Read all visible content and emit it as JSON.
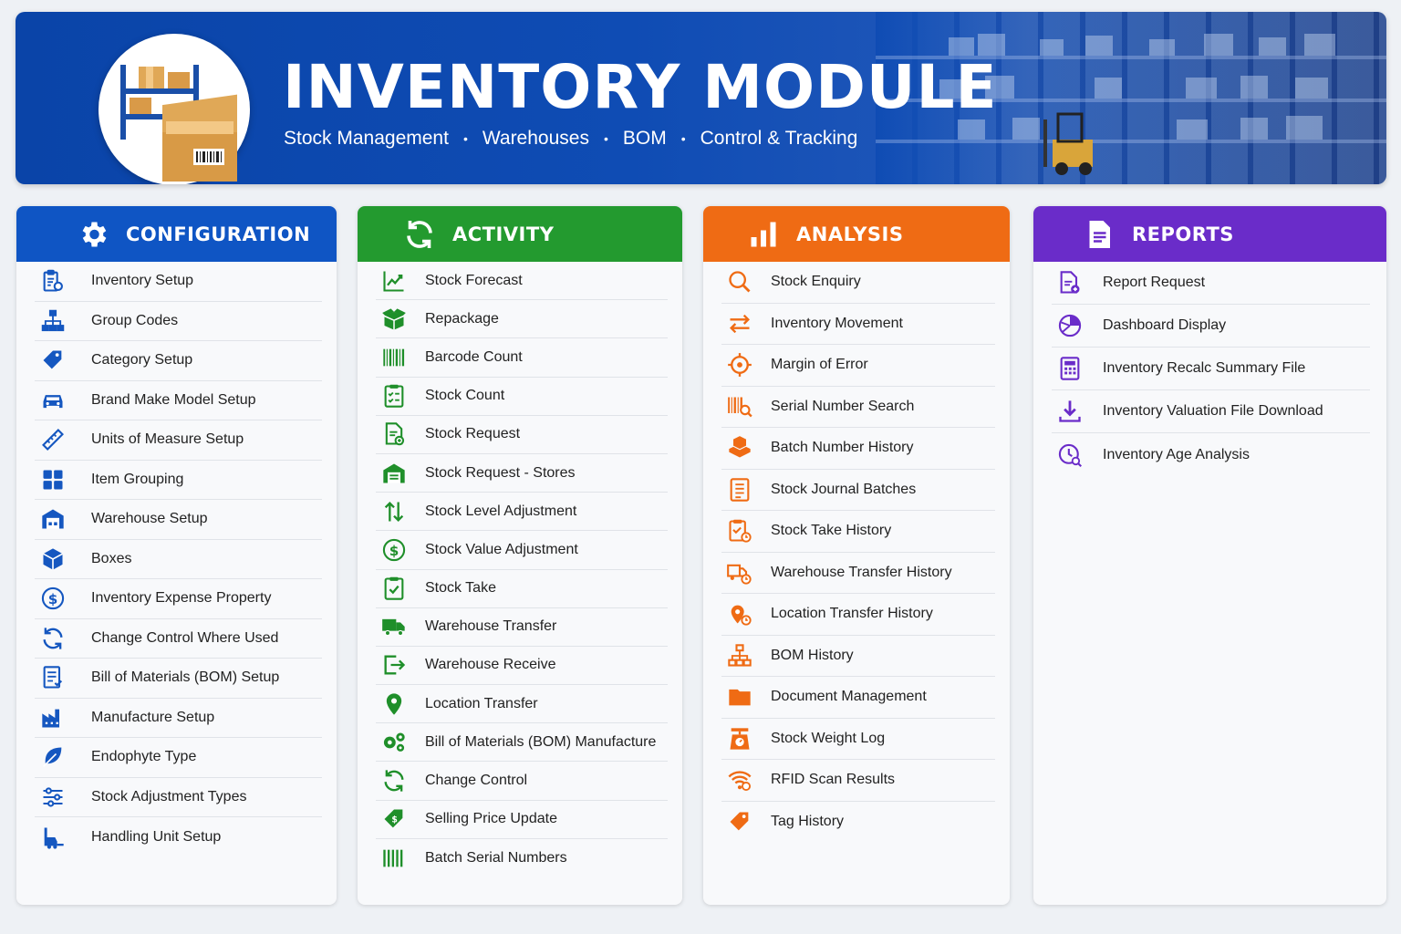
{
  "header": {
    "title": "INVENTORY MODULE",
    "subtitle_items": [
      "Stock Management",
      "Warehouses",
      "BOM",
      "Control & Tracking"
    ],
    "separator": "•"
  },
  "colors": {
    "configuration": "#0f55c4",
    "activity": "#239a2f",
    "analysis": "#ef6b14",
    "reports": "#6a2cc9",
    "banner": "#0f4cb4"
  },
  "configuration": {
    "title": "CONFIGURATION",
    "icon": "gear-icon",
    "items": [
      {
        "label": "Inventory Setup",
        "icon": "clipboard-gear-icon"
      },
      {
        "label": "Group Codes",
        "icon": "hierarchy-icon"
      },
      {
        "label": "Category Setup",
        "icon": "tag-icon"
      },
      {
        "label": "Brand Make Model Setup",
        "icon": "car-icon"
      },
      {
        "label": "Units of Measure Setup",
        "icon": "ruler-icon"
      },
      {
        "label": "Item Grouping",
        "icon": "grid-icon"
      },
      {
        "label": "Warehouse Setup",
        "icon": "warehouse-icon"
      },
      {
        "label": "Boxes",
        "icon": "box-icon"
      },
      {
        "label": "Inventory Expense Property",
        "icon": "dollar-circle-icon"
      },
      {
        "label": "Change Control Where Used",
        "icon": "refresh-icon"
      },
      {
        "label": "Bill of Materials (BOM) Setup",
        "icon": "document-list-icon"
      },
      {
        "label": "Manufacture Setup",
        "icon": "factory-icon"
      },
      {
        "label": "Endophyte Type",
        "icon": "leaf-icon"
      },
      {
        "label": "Stock Adjustment Types",
        "icon": "sliders-icon"
      },
      {
        "label": "Handling Unit Setup",
        "icon": "forklift-icon"
      }
    ]
  },
  "activity": {
    "title": "ACTIVITY",
    "icon": "sync-icon",
    "items": [
      {
        "label": "Stock Forecast",
        "icon": "trend-chart-icon"
      },
      {
        "label": "Repackage",
        "icon": "open-box-icon"
      },
      {
        "label": "Barcode Count",
        "icon": "barcode-icon"
      },
      {
        "label": "Stock Count",
        "icon": "checklist-icon"
      },
      {
        "label": "Stock Request",
        "icon": "document-request-icon"
      },
      {
        "label": "Stock Request - Stores",
        "icon": "store-icon"
      },
      {
        "label": "Stock Level Adjustment",
        "icon": "up-down-arrows-icon"
      },
      {
        "label": "Stock Value Adjustment",
        "icon": "dollar-circle-icon"
      },
      {
        "label": "Stock Take",
        "icon": "clipboard-check-icon"
      },
      {
        "label": "Warehouse Transfer",
        "icon": "truck-icon"
      },
      {
        "label": "Warehouse Receive",
        "icon": "sign-in-icon"
      },
      {
        "label": "Location Transfer",
        "icon": "map-pin-icon"
      },
      {
        "label": "Bill of Materials (BOM) Manufacture",
        "icon": "gears-icon"
      },
      {
        "label": "Change Control",
        "icon": "refresh-icon"
      },
      {
        "label": "Selling Price Update",
        "icon": "price-tag-icon"
      },
      {
        "label": "Batch Serial Numbers",
        "icon": "barcode-icon"
      }
    ]
  },
  "analysis": {
    "title": "ANALYSIS",
    "icon": "bar-chart-icon",
    "items": [
      {
        "label": "Stock Enquiry",
        "icon": "search-icon"
      },
      {
        "label": "Inventory Movement",
        "icon": "swap-arrows-icon"
      },
      {
        "label": "Margin of Error",
        "icon": "crosshair-icon"
      },
      {
        "label": "Serial Number Search",
        "icon": "barcode-search-icon"
      },
      {
        "label": "Batch Number History",
        "icon": "stacked-boxes-icon"
      },
      {
        "label": "Stock Journal Batches",
        "icon": "journal-icon"
      },
      {
        "label": "Stock Take History",
        "icon": "clipboard-clock-icon"
      },
      {
        "label": "Warehouse Transfer History",
        "icon": "truck-clock-icon"
      },
      {
        "label": "Location Transfer History",
        "icon": "pin-clock-icon"
      },
      {
        "label": "BOM History",
        "icon": "hierarchy-icon"
      },
      {
        "label": "Document Management",
        "icon": "folder-icon"
      },
      {
        "label": "Stock Weight Log",
        "icon": "scale-icon"
      },
      {
        "label": "RFID Scan Results",
        "icon": "rfid-icon"
      },
      {
        "label": "Tag History",
        "icon": "tag-icon"
      }
    ]
  },
  "reports": {
    "title": "REPORTS",
    "icon": "document-icon",
    "items": [
      {
        "label": "Report Request",
        "icon": "document-add-icon"
      },
      {
        "label": "Dashboard Display",
        "icon": "pie-chart-icon"
      },
      {
        "label": "Inventory Recalc Summary File",
        "icon": "calculator-icon"
      },
      {
        "label": "Inventory Valuation File Download",
        "icon": "download-icon"
      },
      {
        "label": "Inventory Age Analysis",
        "icon": "clock-search-icon"
      }
    ]
  }
}
